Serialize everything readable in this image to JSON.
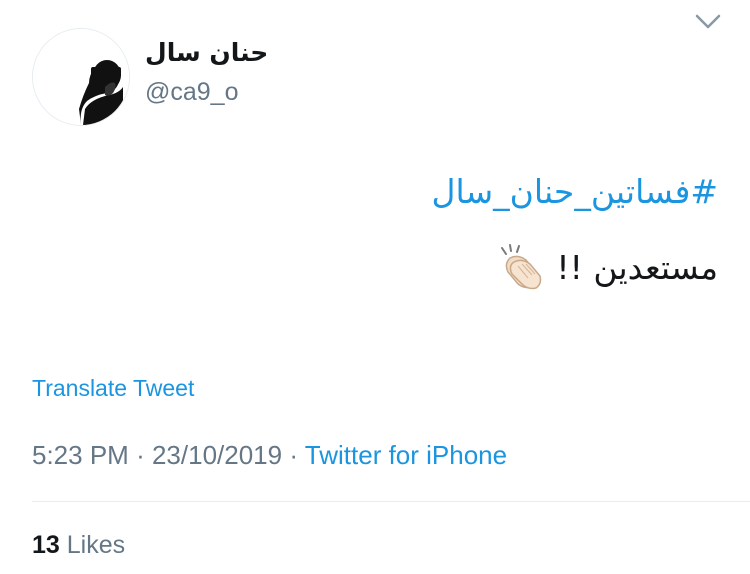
{
  "author": {
    "display_name": "حنان سال",
    "handle": "@ca9_o",
    "avatar_icon": "person-silhouette-icon"
  },
  "tweet": {
    "hashtag": "#فساتين_حنان_سال",
    "text": "مستعدين !!",
    "emoji_icon": "clapping-hands-icon",
    "translate_label": "Translate Tweet",
    "time": "5:23 PM",
    "separator": "·",
    "date": "23/10/2019",
    "source": "Twitter for iPhone"
  },
  "stats": {
    "likes_count": "13",
    "likes_label": "Likes"
  },
  "menu": {
    "icon": "chevron-down-icon"
  },
  "colors": {
    "link": "#1b95e0",
    "secondary_text": "#657786",
    "primary_text": "#14171a",
    "divider": "#e6ecf0"
  }
}
